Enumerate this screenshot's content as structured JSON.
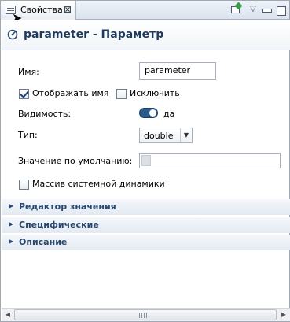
{
  "tab": {
    "label": "Свойства",
    "icon": "properties-view-icon",
    "close_glyph": "⊠"
  },
  "toolbar": {
    "pin_icon": "pin-view-icon",
    "menu_glyph": "▽",
    "minimize_icon": "minimize-icon",
    "maximize_icon": "maximize-icon"
  },
  "header": {
    "icon": "parameter-icon",
    "title": "parameter - Параметр"
  },
  "form": {
    "name_label": "Имя:",
    "name_value": "parameter",
    "show_name_label": "Отображать имя",
    "show_name_checked": true,
    "exclude_label": "Исключить",
    "exclude_checked": false,
    "visibility_label": "Видимость:",
    "visibility_on": true,
    "visibility_value": "да",
    "type_label": "Тип:",
    "type_value": "double",
    "default_label": "Значение по умолчанию:",
    "default_value": "",
    "sysdyn_array_label": "Массив системной динамики",
    "sysdyn_array_checked": false
  },
  "sections": [
    {
      "label": "Редактор значения",
      "expanded": false
    },
    {
      "label": "Специфические",
      "expanded": false
    },
    {
      "label": "Описание",
      "expanded": false
    }
  ],
  "colors": {
    "header_title": "#1f3a5c",
    "section_label": "#27476f",
    "toggle_on": "#2c5b8a"
  }
}
